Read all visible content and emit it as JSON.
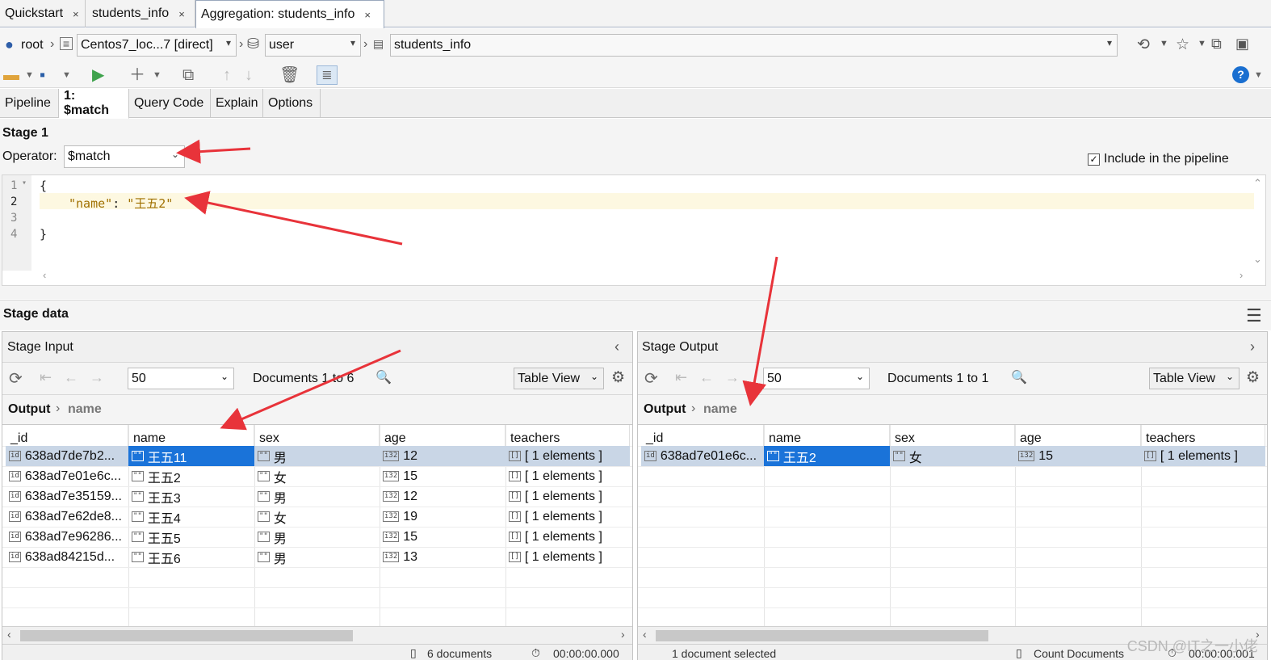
{
  "doc_tabs": [
    {
      "label": "Quickstart",
      "close": "×"
    },
    {
      "label": "students_info",
      "close": "×"
    },
    {
      "label": "Aggregation: students_info",
      "close": "×"
    }
  ],
  "connection": {
    "user": "root",
    "server": "Centos7_loc...7 [direct]",
    "database": "user",
    "collection": "students_info"
  },
  "pipeline_tabs": [
    "Pipeline",
    "1: $match",
    "Query Code",
    "Explain",
    "Options"
  ],
  "stage": {
    "title": "Stage 1",
    "operator_label": "Operator:",
    "operator_value": "$match",
    "include_label": "Include in the pipeline",
    "include_checked": true
  },
  "editor": {
    "line_numbers": [
      "1",
      "2",
      "3",
      "4"
    ],
    "line1": "{",
    "line2_key": "\"name\"",
    "line2_colon": ": ",
    "line2_value": "\"王五2\"",
    "line4": "}"
  },
  "stage_data": {
    "title": "Stage data"
  },
  "input_panel": {
    "title": "Stage Input",
    "page_size": "50",
    "doc_range": "Documents 1 to 6",
    "view": "Table View",
    "breadcrumb_root": "Output",
    "breadcrumb_field": "name",
    "columns": [
      "_id",
      "name",
      "sex",
      "age",
      "teachers"
    ],
    "rows": [
      {
        "id": "638ad7de7b2...",
        "name": "王五11",
        "sex": "男",
        "age": "12",
        "teachers": "[ 1 elements ]"
      },
      {
        "id": "638ad7e01e6c...",
        "name": "王五2",
        "sex": "女",
        "age": "15",
        "teachers": "[ 1 elements ]"
      },
      {
        "id": "638ad7e35159...",
        "name": "王五3",
        "sex": "男",
        "age": "12",
        "teachers": "[ 1 elements ]"
      },
      {
        "id": "638ad7e62de8...",
        "name": "王五4",
        "sex": "女",
        "age": "19",
        "teachers": "[ 1 elements ]"
      },
      {
        "id": "638ad7e96286...",
        "name": "王五5",
        "sex": "男",
        "age": "15",
        "teachers": "[ 1 elements ]"
      },
      {
        "id": "638ad84215d...",
        "name": "王五6",
        "sex": "男",
        "age": "13",
        "teachers": "[ 1 elements ]"
      }
    ],
    "status_count": "6 documents",
    "status_time": "00:00:00.000"
  },
  "output_panel": {
    "title": "Stage Output",
    "page_size": "50",
    "doc_range": "Documents 1 to 1",
    "view": "Table View",
    "breadcrumb_root": "Output",
    "breadcrumb_field": "name",
    "columns": [
      "_id",
      "name",
      "sex",
      "age",
      "teachers"
    ],
    "rows": [
      {
        "id": "638ad7e01e6c...",
        "name": "王五2",
        "sex": "女",
        "age": "15",
        "teachers": "[ 1 elements ]"
      }
    ],
    "status_selected": "1 document selected",
    "status_count_btn": "Count Documents",
    "status_time": "00:00:00.001"
  },
  "type_icons": {
    "id": "id",
    "string": "\"\"",
    "int": "i32",
    "array": "[]"
  },
  "watermark": "CSDN @IT之一小佬",
  "colors": {
    "selection": "#1a73d9",
    "selected_row": "#c9d6e6",
    "annotation_arrow": "#e8333a"
  }
}
